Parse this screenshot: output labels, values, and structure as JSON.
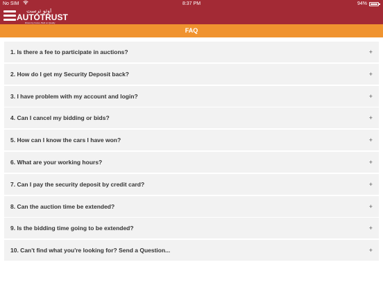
{
  "status_bar": {
    "carrier": "No SIM",
    "time": "8:37 PM",
    "battery": "94%"
  },
  "header": {
    "logo_arabic": "اوتو ترست",
    "logo_text": "AUTOTRUST",
    "logo_tagline": "Driven by Focus, Built on Quality"
  },
  "page": {
    "title": "FAQ"
  },
  "faq": {
    "expand_symbol": "+",
    "items": [
      {
        "question": "1. Is there a fee to participate in auctions?"
      },
      {
        "question": "2. How do I get my Security Deposit back?"
      },
      {
        "question": "3. I have problem with my account and login?"
      },
      {
        "question": "4. Can I cancel my bidding or bids?"
      },
      {
        "question": "5. How can I know the cars I have won?"
      },
      {
        "question": "6. What are your working hours?"
      },
      {
        "question": "7. Can I pay the security deposit by credit card?"
      },
      {
        "question": "8. Can the auction time be extended?"
      },
      {
        "question": "9. Is the bidding time going to be extended?"
      },
      {
        "question": "10. Can't find what you're looking for? Send a Question..."
      }
    ]
  },
  "colors": {
    "header_bg": "#a32a35",
    "titlebar_bg": "#f0932f",
    "item_bg": "#f2f2f2"
  },
  "icons": {
    "menu": "hamburger-menu-icon",
    "wifi": "wifi-icon",
    "battery": "battery-icon",
    "expand": "plus-icon"
  }
}
